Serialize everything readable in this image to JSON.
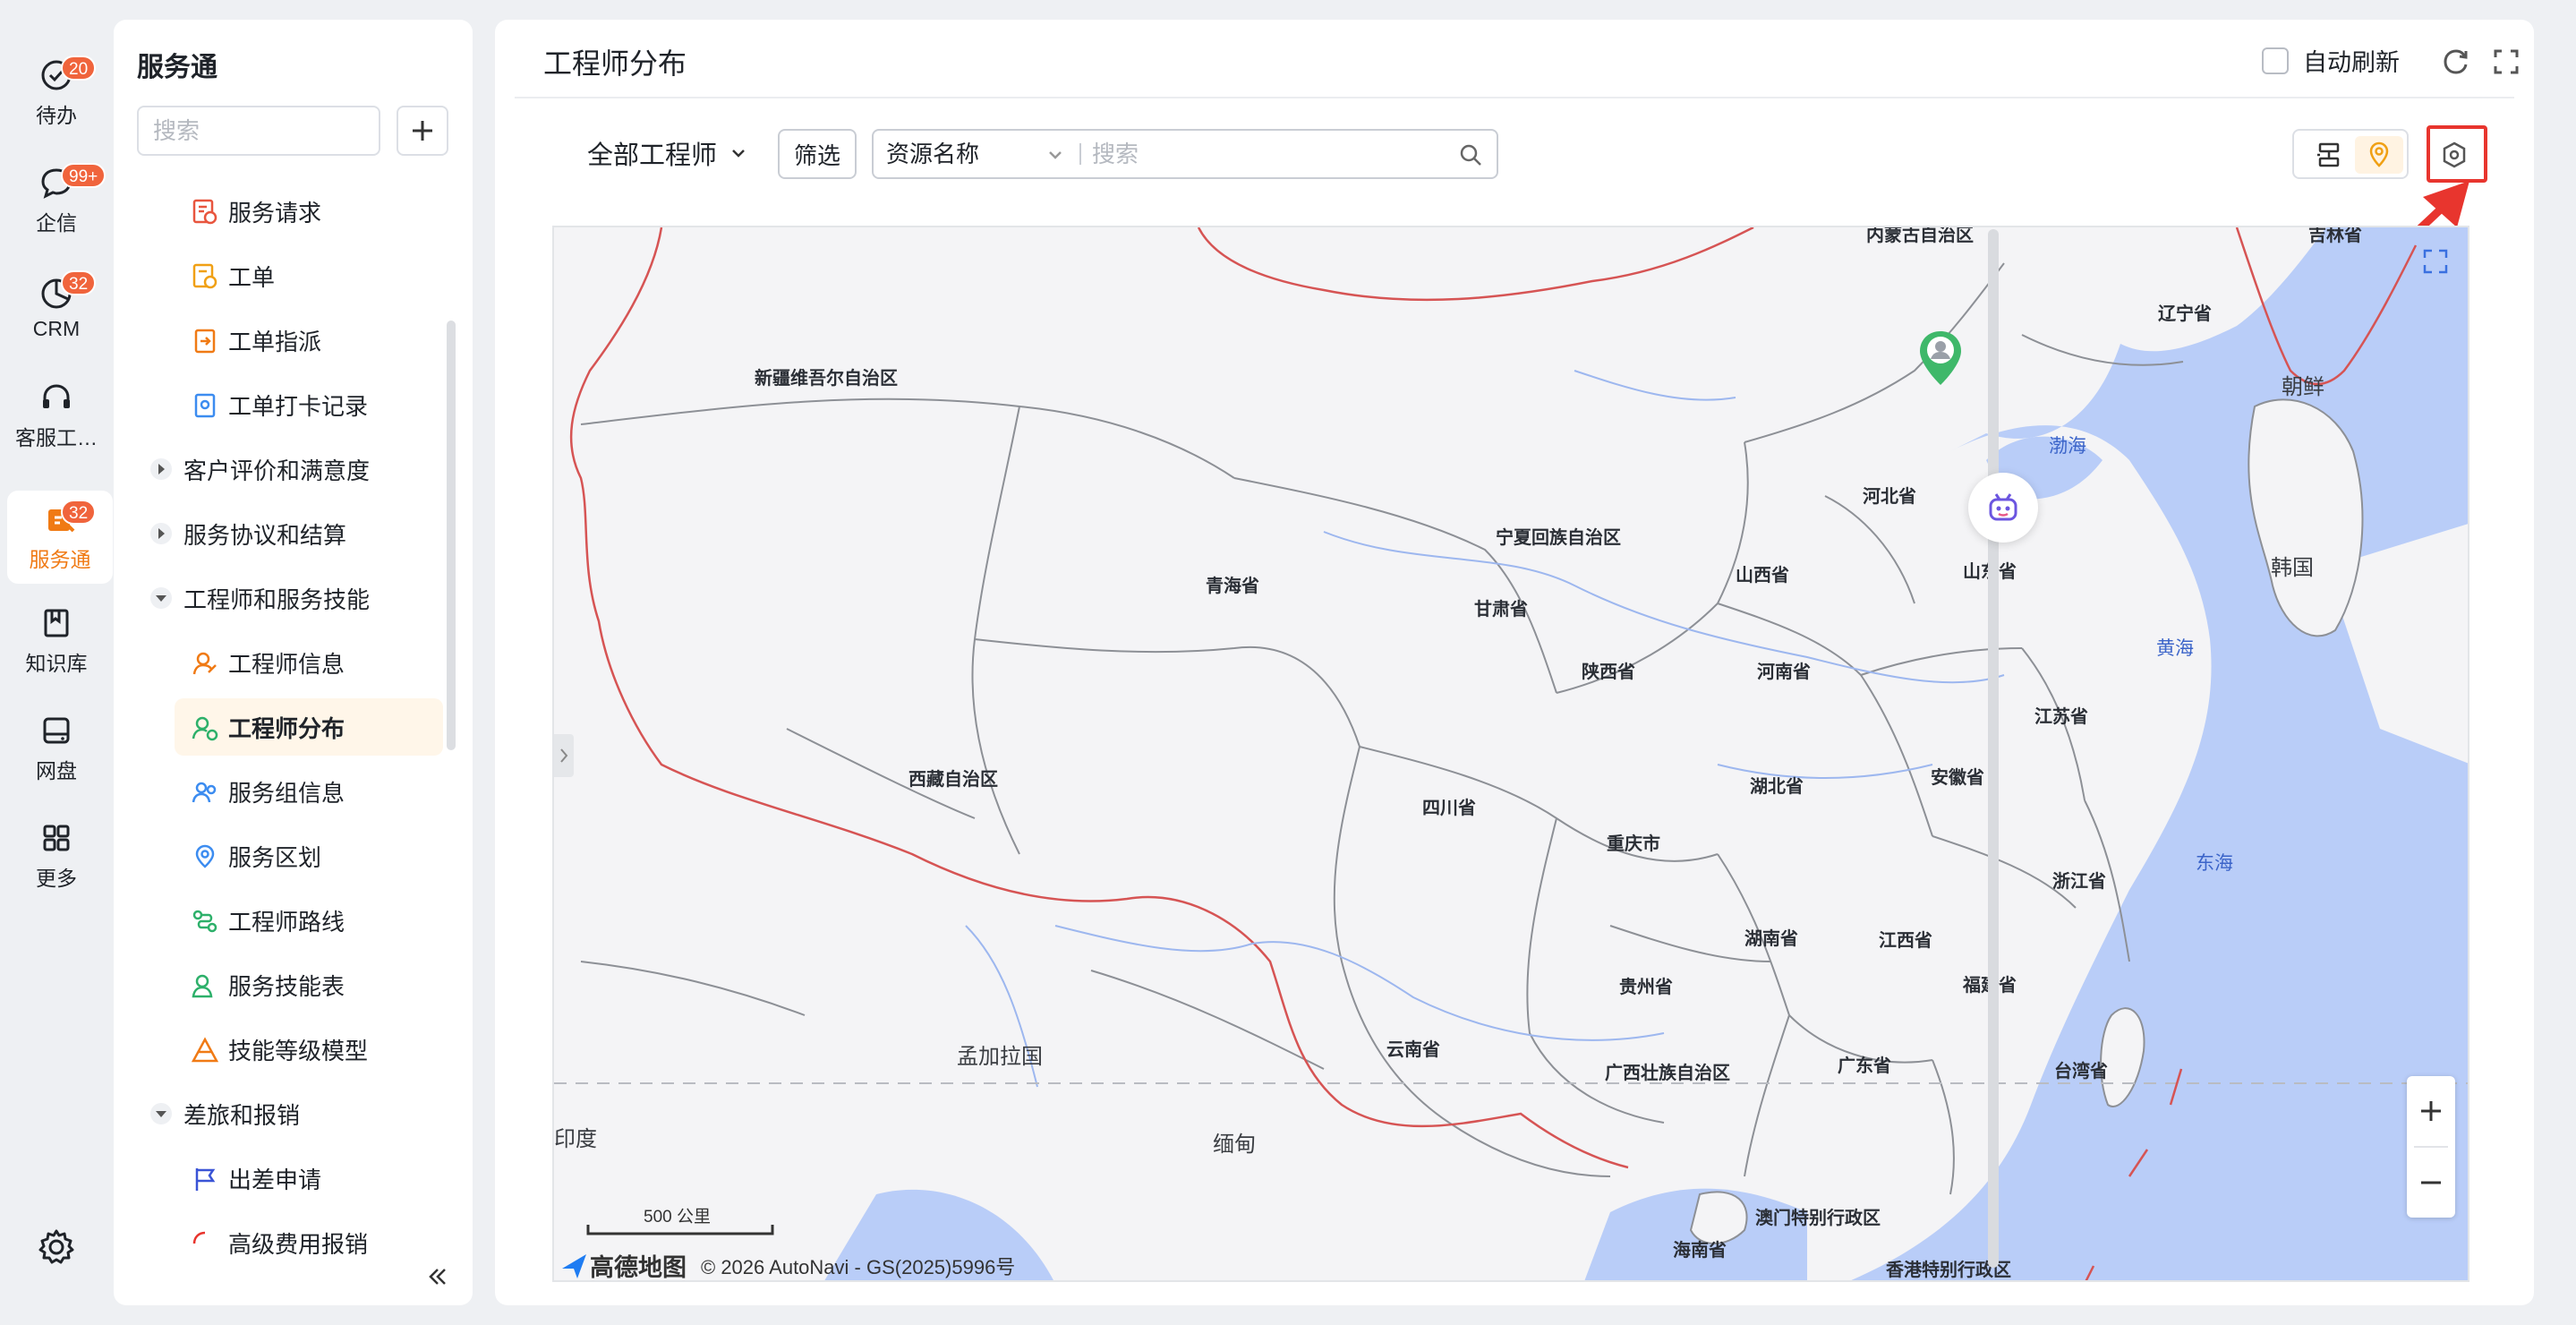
{
  "rail": {
    "items": [
      {
        "label": "待办",
        "badge": "20",
        "icon": "todo-check-icon"
      },
      {
        "label": "企信",
        "badge": "99+",
        "icon": "chat-bubble-icon"
      },
      {
        "label": "CRM",
        "badge": "32",
        "icon": "crm-pie-icon"
      },
      {
        "label": "客服工…",
        "badge": "",
        "icon": "headset-icon"
      },
      {
        "label": "服务通",
        "badge": "32",
        "icon": "service-tool-icon"
      },
      {
        "label": "知识库",
        "badge": "",
        "icon": "book-icon"
      },
      {
        "label": "网盘",
        "badge": "",
        "icon": "disk-icon"
      },
      {
        "label": "更多",
        "badge": "",
        "icon": "grid-apps-icon"
      }
    ],
    "active_index": 4,
    "settings_icon": "gear-icon"
  },
  "nav": {
    "title": "服务通",
    "search_placeholder": "搜索",
    "items": [
      {
        "type": "sub",
        "label": "服务请求"
      },
      {
        "type": "sub",
        "label": "工单"
      },
      {
        "type": "sub",
        "label": "工单指派"
      },
      {
        "type": "sub",
        "label": "工单打卡记录"
      },
      {
        "type": "group",
        "label": "客户评价和满意度",
        "expanded": false
      },
      {
        "type": "group",
        "label": "服务协议和结算",
        "expanded": false
      },
      {
        "type": "group",
        "label": "工程师和服务技能",
        "expanded": true
      },
      {
        "type": "sub",
        "label": "工程师信息"
      },
      {
        "type": "sub",
        "label": "工程师分布",
        "active": true
      },
      {
        "type": "sub",
        "label": "服务组信息"
      },
      {
        "type": "sub",
        "label": "服务区划"
      },
      {
        "type": "sub",
        "label": "工程师路线"
      },
      {
        "type": "sub",
        "label": "服务技能表"
      },
      {
        "type": "sub",
        "label": "技能等级模型"
      },
      {
        "type": "group",
        "label": "差旅和报销",
        "expanded": true
      },
      {
        "type": "sub",
        "label": "出差申请"
      },
      {
        "type": "sub",
        "label": "高级费用报销"
      }
    ]
  },
  "main": {
    "title": "工程师分布",
    "auto_refresh_label": "自动刷新",
    "auto_refresh_checked": false,
    "scope_label": "全部工程师",
    "filter_label": "筛选",
    "resource_select": "资源名称",
    "search_placeholder": "搜索"
  },
  "map": {
    "scale_label": "500 公里",
    "brand_name": "高德地图",
    "copyright": "© 2026 AutoNavi - GS(2025)5996号",
    "labels": [
      {
        "text": "内蒙古自治区",
        "kind": "region"
      },
      {
        "text": "吉林省",
        "kind": "region"
      },
      {
        "text": "辽宁省",
        "kind": "region"
      },
      {
        "text": "新疆维吾尔自治区",
        "kind": "region"
      },
      {
        "text": "河北省",
        "kind": "region"
      },
      {
        "text": "宁夏回族自治区",
        "kind": "region"
      },
      {
        "text": "青海省",
        "kind": "region"
      },
      {
        "text": "山西省",
        "kind": "region"
      },
      {
        "text": "山东省",
        "kind": "region"
      },
      {
        "text": "甘肃省",
        "kind": "region"
      },
      {
        "text": "陕西省",
        "kind": "region"
      },
      {
        "text": "河南省",
        "kind": "region"
      },
      {
        "text": "江苏省",
        "kind": "region"
      },
      {
        "text": "西藏自治区",
        "kind": "region"
      },
      {
        "text": "湖北省",
        "kind": "region"
      },
      {
        "text": "安徽省",
        "kind": "region"
      },
      {
        "text": "四川省",
        "kind": "region"
      },
      {
        "text": "重庆市",
        "kind": "region"
      },
      {
        "text": "浙江省",
        "kind": "region"
      },
      {
        "text": "湖南省",
        "kind": "region"
      },
      {
        "text": "江西省",
        "kind": "region"
      },
      {
        "text": "贵州省",
        "kind": "region"
      },
      {
        "text": "福建省",
        "kind": "region"
      },
      {
        "text": "云南省",
        "kind": "region"
      },
      {
        "text": "广西壮族自治区",
        "kind": "region"
      },
      {
        "text": "广东省",
        "kind": "region"
      },
      {
        "text": "台湾省",
        "kind": "region"
      },
      {
        "text": "澳门特别行政区",
        "kind": "region"
      },
      {
        "text": "香港特别行政区",
        "kind": "region"
      },
      {
        "text": "海南省",
        "kind": "region"
      },
      {
        "text": "渤海",
        "kind": "sea"
      },
      {
        "text": "黄海",
        "kind": "sea"
      },
      {
        "text": "东海",
        "kind": "sea"
      },
      {
        "text": "朝鲜",
        "kind": "foreign"
      },
      {
        "text": "韩国",
        "kind": "foreign"
      },
      {
        "text": "孟加拉国",
        "kind": "foreign"
      },
      {
        "text": "缅甸",
        "kind": "foreign"
      },
      {
        "text": "印度",
        "kind": "foreign"
      }
    ]
  },
  "colors": {
    "accent": "#f07a14",
    "badge": "#f0643c",
    "sea": "#b9cdf8",
    "highlight": "#e8352e",
    "marker": "#3fb86a"
  }
}
